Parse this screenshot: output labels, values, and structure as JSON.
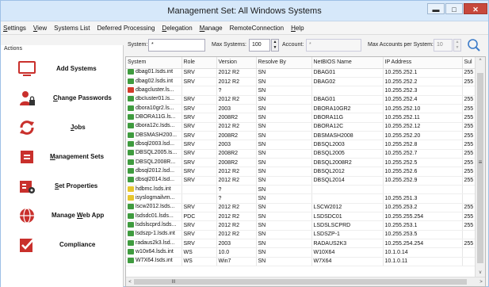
{
  "window": {
    "title": "Management Set: All Windows Systems",
    "minimize_glyph": "▬",
    "maximize_glyph": "□",
    "close_glyph": "✕"
  },
  "menu": [
    {
      "label": "Settings",
      "key": "S",
      "rest": "ettings"
    },
    {
      "label": "View",
      "key": "V",
      "rest": "iew"
    },
    {
      "label": "Systems List",
      "key": "",
      "rest": "Systems List"
    },
    {
      "label": "Deferred Processing",
      "key": "",
      "rest": "Deferred Processing"
    },
    {
      "label": "Delegation",
      "key": "D",
      "rest": "elegation"
    },
    {
      "label": "Manage",
      "key": "M",
      "rest": "anage"
    },
    {
      "label": "RemoteConnection",
      "key": "",
      "rest": "RemoteConnection"
    },
    {
      "label": "Help",
      "key": "H",
      "rest": "elp"
    }
  ],
  "search": {
    "system_label": "System:",
    "system_value": "*",
    "max_systems_label": "Max Systems:",
    "max_systems_value": "100",
    "account_label": "Account:",
    "account_value": "*",
    "max_accounts_label": "Max Accounts per System:",
    "max_accounts_value": "10"
  },
  "actions_header": "Actions",
  "actions": [
    {
      "label": "Add Systems",
      "icon": "monitor-icon",
      "key": "",
      "rest": "Add Systems"
    },
    {
      "label": "Change Passwords",
      "icon": "user-lock-icon",
      "key": "C",
      "rest": "hange Passwords"
    },
    {
      "label": "Jobs",
      "icon": "refresh-icon",
      "key": "J",
      "rest": "obs"
    },
    {
      "label": "Management Sets",
      "icon": "server-list-icon",
      "key": "M",
      "rest": "anagement Sets"
    },
    {
      "label": "Set Properties",
      "icon": "properties-icon",
      "key": "S",
      "rest": "et Properties"
    },
    {
      "label": "Manage Web App",
      "icon": "globe-icon",
      "key": "W",
      "pre": "Manage ",
      "rest": "eb App"
    },
    {
      "label": "Compliance",
      "icon": "checkmark-icon",
      "key": "",
      "rest": "Compliance"
    }
  ],
  "table": {
    "columns": [
      "System",
      "Role",
      "Version",
      "Resolve By",
      "NetBIOS Name",
      "IP Address",
      "Sul"
    ],
    "rows": [
      {
        "flag": "green",
        "system": "dbag01.lsds.int",
        "role": "SRV",
        "version": "2012 R2",
        "resolve": "SN",
        "netbios": "DBAG01",
        "ip": "10.255.252.1",
        "sub": "255"
      },
      {
        "flag": "green",
        "system": "dbag02.lsds.int",
        "role": "SRV",
        "version": "2012 R2",
        "resolve": "SN",
        "netbios": "DBAG02",
        "ip": "10.255.252.2",
        "sub": "255"
      },
      {
        "flag": "red",
        "system": "dbagcluster.ls...",
        "role": "",
        "version": "?",
        "resolve": "SN",
        "netbios": "",
        "ip": "10.255.252.3",
        "sub": ""
      },
      {
        "flag": "green",
        "system": "dbcluster01.ls...",
        "role": "SRV",
        "version": "2012 R2",
        "resolve": "SN",
        "netbios": "DBAG01",
        "ip": "10.255.252.4",
        "sub": "255"
      },
      {
        "flag": "green",
        "system": "dbora10gr2.ls...",
        "role": "SRV",
        "version": "2003",
        "resolve": "SN",
        "netbios": "DBORA10GR2",
        "ip": "10.255.252.10",
        "sub": "255"
      },
      {
        "flag": "green",
        "system": "DBORA11G.ls...",
        "role": "SRV",
        "version": "2008R2",
        "resolve": "SN",
        "netbios": "DBORA11G",
        "ip": "10.255.252.11",
        "sub": "255"
      },
      {
        "flag": "green",
        "system": "dbora12c.lsds...",
        "role": "SRV",
        "version": "2012 R2",
        "resolve": "SN",
        "netbios": "DBORA12C",
        "ip": "10.255.252.12",
        "sub": "255"
      },
      {
        "flag": "green",
        "system": "DBSMASH200...",
        "role": "SRV",
        "version": "2008R2",
        "resolve": "SN",
        "netbios": "DBSMASH2008",
        "ip": "10.255.252.20",
        "sub": "255"
      },
      {
        "flag": "green",
        "system": "dbsql2003.lsd...",
        "role": "SRV",
        "version": "2003",
        "resolve": "SN",
        "netbios": "DBSQL2003",
        "ip": "10.255.252.8",
        "sub": "255"
      },
      {
        "flag": "green",
        "system": "DBSQL2005.ls...",
        "role": "SRV",
        "version": "2008R2",
        "resolve": "SN",
        "netbios": "DBSQL2005",
        "ip": "10.255.252.7",
        "sub": "255"
      },
      {
        "flag": "green",
        "system": "DBSQL2008R...",
        "role": "SRV",
        "version": "2008R2",
        "resolve": "SN",
        "netbios": "DBSQL2008R2",
        "ip": "10.255.252.5",
        "sub": "255"
      },
      {
        "flag": "green",
        "system": "dbsql2012.lsd...",
        "role": "SRV",
        "version": "2012 R2",
        "resolve": "SN",
        "netbios": "DBSQL2012",
        "ip": "10.255.252.6",
        "sub": "255"
      },
      {
        "flag": "green",
        "system": "dbsql2014.lsd...",
        "role": "SRV",
        "version": "2012 R2",
        "resolve": "SN",
        "netbios": "DBSQL2014",
        "ip": "10.255.252.9",
        "sub": "255"
      },
      {
        "flag": "yellow",
        "system": "hdbmc.lsds.int",
        "role": "",
        "version": "?",
        "resolve": "SN",
        "netbios": "",
        "ip": "",
        "sub": ""
      },
      {
        "flag": "yellow",
        "system": "isyslogmailvm...",
        "role": "",
        "version": "?",
        "resolve": "SN",
        "netbios": "",
        "ip": "10.255.251.3",
        "sub": ""
      },
      {
        "flag": "green",
        "system": "lscw2012.lsds...",
        "role": "SRV",
        "version": "2012 R2",
        "resolve": "SN",
        "netbios": "LSCW2012",
        "ip": "10.255.253.2",
        "sub": "255"
      },
      {
        "flag": "green",
        "system": "lsdsdc01.lsds...",
        "role": "PDC",
        "version": "2012 R2",
        "resolve": "SN",
        "netbios": "LSDSDC01",
        "ip": "10.255.255.254",
        "sub": "255"
      },
      {
        "flag": "green",
        "system": "lsdslscprd.lsds...",
        "role": "SRV",
        "version": "2012 R2",
        "resolve": "SN",
        "netbios": "LSDSLSCPRD",
        "ip": "10.255.253.1",
        "sub": "255"
      },
      {
        "flag": "green",
        "system": "lsdszp-1.lsds.int",
        "role": "SRV",
        "version": "2012 R2",
        "resolve": "SN",
        "netbios": "LSDSZP-1",
        "ip": "10.255.253.5",
        "sub": ""
      },
      {
        "flag": "green",
        "system": "radaus2k3.lsd...",
        "role": "SRV",
        "version": "2003",
        "resolve": "SN",
        "netbios": "RADAUS2K3",
        "ip": "10.255.254.254",
        "sub": "255"
      },
      {
        "flag": "green",
        "system": "w10x64.lsds.int",
        "role": "WS",
        "version": "10.0",
        "resolve": "SN",
        "netbios": "W10X64",
        "ip": "10.1.0.14",
        "sub": ""
      },
      {
        "flag": "green",
        "system": "W7X64.lsds.int",
        "role": "WS",
        "version": "Win7",
        "resolve": "SN",
        "netbios": "W7X64",
        "ip": "10.1.0.11",
        "sub": ""
      }
    ]
  },
  "scroll": {
    "up_glyph": "^",
    "down_glyph": "v",
    "left_glyph": "<",
    "right_glyph": ">",
    "grip_glyph": "III",
    "vgrip_glyph": "≡"
  },
  "colors": {
    "title_bar": "#d6e8fa",
    "close_button": "#c7483c",
    "status_ok": "#3f9b3f",
    "status_error": "#d23a2a",
    "status_unknown": "#e6c62d"
  }
}
